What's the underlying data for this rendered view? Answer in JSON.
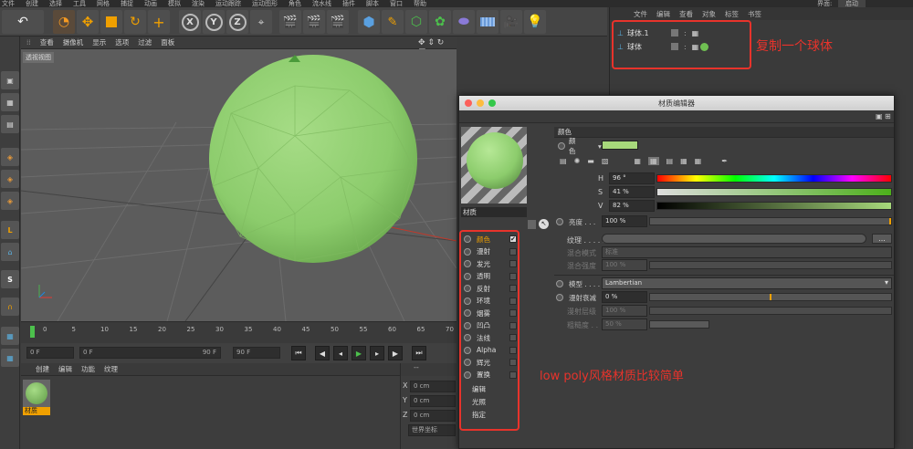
{
  "topbar": {
    "menus": [
      "文件",
      "创建",
      "选择",
      "工具",
      "网格",
      "捕捉",
      "动画",
      "模拟",
      "渲染",
      "运动跟踪",
      "运动图形",
      "角色",
      "流水线",
      "插件",
      "脚本",
      "窗口",
      "帮助"
    ],
    "layout_label": "界面:",
    "layout_value": "启动"
  },
  "toolbar": {
    "axis_x": "X",
    "axis_y": "Y",
    "axis_z": "Z"
  },
  "viewport": {
    "menus": [
      "查看",
      "摄像机",
      "显示",
      "选项",
      "过滤",
      "面板"
    ],
    "view_label": "透视视图"
  },
  "timeline": {
    "ticks": [
      "0",
      "5",
      "10",
      "15",
      "20",
      "25",
      "30",
      "35",
      "40",
      "45",
      "50",
      "55",
      "60",
      "65",
      "70"
    ]
  },
  "playbar": {
    "start": "0 F",
    "current": "0 F",
    "end_a": "90 F",
    "end_b": "90 F"
  },
  "material_manager": {
    "menus": [
      "创建",
      "编辑",
      "功能",
      "纹理"
    ],
    "material_name": "材质"
  },
  "coords": {
    "header": "--",
    "x_label": "X",
    "x_value": "0 cm",
    "y_label": "Y",
    "y_value": "0 cm",
    "z_label": "Z",
    "z_value": "0 cm",
    "world_label": "世界坐标"
  },
  "object_manager": {
    "menus": [
      "文件",
      "编辑",
      "查看",
      "对象",
      "标签",
      "书签"
    ],
    "objects": [
      {
        "name": "球体.1"
      },
      {
        "name": "球体"
      }
    ]
  },
  "annotations": {
    "copy_sphere": "复制一个球体",
    "lowpoly": "low poly风格材质比较简单"
  },
  "material_editor": {
    "title": "材质编辑器",
    "material_name": "材质",
    "channels": [
      {
        "label": "颜色",
        "checked": true
      },
      {
        "label": "漫射",
        "checked": false
      },
      {
        "label": "发光",
        "checked": false
      },
      {
        "label": "透明",
        "checked": false
      },
      {
        "label": "反射",
        "checked": false
      },
      {
        "label": "环境",
        "checked": false
      },
      {
        "label": "烟雾",
        "checked": false
      },
      {
        "label": "凹凸",
        "checked": false
      },
      {
        "label": "法线",
        "checked": false
      },
      {
        "label": "Alpha",
        "checked": false
      },
      {
        "label": "辉光",
        "checked": false
      },
      {
        "label": "置换",
        "checked": false
      }
    ],
    "extra_items": [
      "编辑",
      "光照",
      "指定"
    ],
    "section": "颜色",
    "color_label": "颜色",
    "color_swatch": "#a7d87b",
    "h_label": "H",
    "h_value": "96 °",
    "s_label": "S",
    "s_value": "41 %",
    "v_label": "V",
    "v_value": "82 %",
    "brightness_label": "亮度 . . .",
    "brightness_value": "100 %",
    "texture_label": "纹理 . . . . .",
    "blend_mode_label": "混合模式",
    "blend_mode_value": "标准",
    "blend_strength_label": "混合强度",
    "blend_strength_value": "100 %",
    "model_label": "模型 . . . . .",
    "model_value": "Lambertian",
    "diffuse_falloff_label": "漫射衰减",
    "diffuse_falloff_value": "0 %",
    "diffuse_level_label": "漫射层级",
    "diffuse_level_value": "100 %",
    "roughness_label": "粗糙度 . .",
    "roughness_value": "50 %",
    "ellipsis": "..."
  },
  "colors": {
    "accent_orange": "#f0a000",
    "annotation_red": "#e8332b",
    "sphere_green": "#8ccc6c"
  }
}
